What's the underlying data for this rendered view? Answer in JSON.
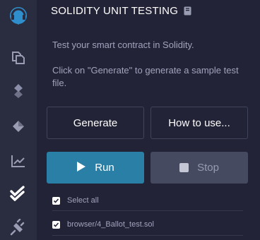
{
  "sidebar": {
    "items": [
      {
        "icon": "remix-logo-icon",
        "active": false
      },
      {
        "icon": "file-explorer-icon",
        "active": false
      },
      {
        "icon": "compiler-icon",
        "active": false
      },
      {
        "icon": "deploy-run-icon",
        "active": false
      },
      {
        "icon": "analytics-icon",
        "active": false
      },
      {
        "icon": "unit-testing-check-icon",
        "active": true
      },
      {
        "icon": "plugin-manager-icon",
        "active": false
      }
    ]
  },
  "header": {
    "title": "SOLIDITY UNIT TESTING",
    "doc_icon": "book-icon"
  },
  "description": {
    "line1": "Test your smart contract in Solidity.",
    "line2": "Click on \"Generate\" to generate a sample test file."
  },
  "buttons": {
    "generate": "Generate",
    "how_to_use": "How to use...",
    "run": "Run",
    "stop": "Stop"
  },
  "tests": {
    "select_all_label": "Select all",
    "select_all_checked": true,
    "files": [
      {
        "label": "browser/4_Ballot_test.sol",
        "checked": true
      }
    ]
  },
  "colors": {
    "background": "#222336",
    "rail": "#2a2c3f",
    "run_button": "#2a7fa7",
    "stop_button": "#464a60",
    "logo_accent": "#2f8fcc"
  }
}
